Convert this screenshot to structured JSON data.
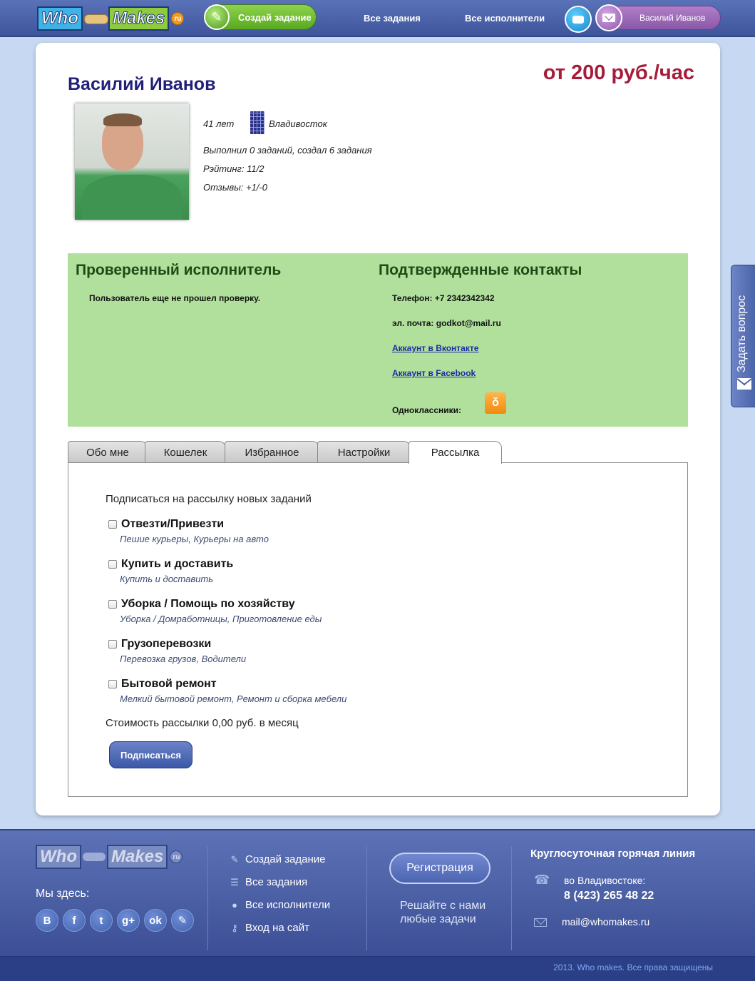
{
  "header": {
    "logo": {
      "who": "Who",
      "makes": "Makes",
      "ru": "ru"
    },
    "create_task": "Создай задание",
    "all_tasks": "Все задания",
    "all_performers": "Все исполнители",
    "user_name": "Василий Иванов"
  },
  "profile": {
    "name": "Василий Иванов",
    "rate": "от 200 руб./час",
    "age": "41 лет",
    "city": "Владивосток",
    "stats": "Выполнил 0 заданий, создал 6 задания",
    "rating": "Рэйтинг: 11/2",
    "reviews": "Отзывы: +1/-0"
  },
  "verification": {
    "checked_title": "Проверенный исполнитель",
    "checked_status": "Пользователь еще не прошел проверку.",
    "contacts_title": "Подтвержденные контакты",
    "phone": "Телефон: +7 2342342342",
    "email": "эл. почта: godkot@mail.ru",
    "vk": "Аккаунт в Вконтакте",
    "facebook": "Аккаунт в Facebook",
    "odnoklassniki": "Одноклассники:"
  },
  "tabs": [
    {
      "label": "Обо мне",
      "active": false
    },
    {
      "label": "Кошелек",
      "active": false
    },
    {
      "label": "Избранное",
      "active": false
    },
    {
      "label": "Настройки",
      "active": false
    },
    {
      "label": "Рассылка",
      "active": true
    }
  ],
  "newsletter": {
    "title": "Подписаться на рассылку новых заданий",
    "categories": [
      {
        "name": "Отвезти/Привезти",
        "desc": "Пешие курьеры, Курьеры на авто",
        "checked": false
      },
      {
        "name": "Купить и доставить",
        "desc": "Купить и доставить",
        "checked": false
      },
      {
        "name": "Уборка / Помощь по хозяйству",
        "desc": "Уборка / Домработницы, Приготовление еды",
        "checked": false
      },
      {
        "name": "Грузоперевозки",
        "desc": "Перевозка грузов, Водители",
        "checked": false
      },
      {
        "name": "Бытовой ремонт",
        "desc": "Мелкий бытовой ремонт, Ремонт и сборка мебели",
        "checked": false
      }
    ],
    "cost": "Стоимость рассылки 0,00 руб. в месяц",
    "subscribe": "Подписаться"
  },
  "ask_question": "Задать вопрос",
  "footer": {
    "logo": {
      "who": "Who",
      "makes": "Makes",
      "ru": "ru"
    },
    "we_here": "Мы здесь:",
    "social": [
      "В",
      "f",
      "t",
      "g+",
      "ok",
      "✎"
    ],
    "menu": [
      "Создай задание",
      "Все задания",
      "Все исполнители",
      "Вход на сайт"
    ],
    "register": "Регистрация",
    "slogan_line1": "Решайте с нами",
    "slogan_line2": "любые задачи",
    "hotline_title": "Круглосуточная горячая линия",
    "hotline_city": "во Владивостоке:",
    "hotline_phone": "8 (423) 265 48 22",
    "email": "mail@whomakes.ru",
    "copyright": "2013. Who makes. Все права защищены"
  },
  "colors": {
    "header_bg": "#4a62aa",
    "rate": "#a51d3a",
    "profile_name": "#21207a",
    "verify_bg": "#b0e09c",
    "create_btn": "#6ebd32",
    "user_pill": "#9a6ab8"
  }
}
